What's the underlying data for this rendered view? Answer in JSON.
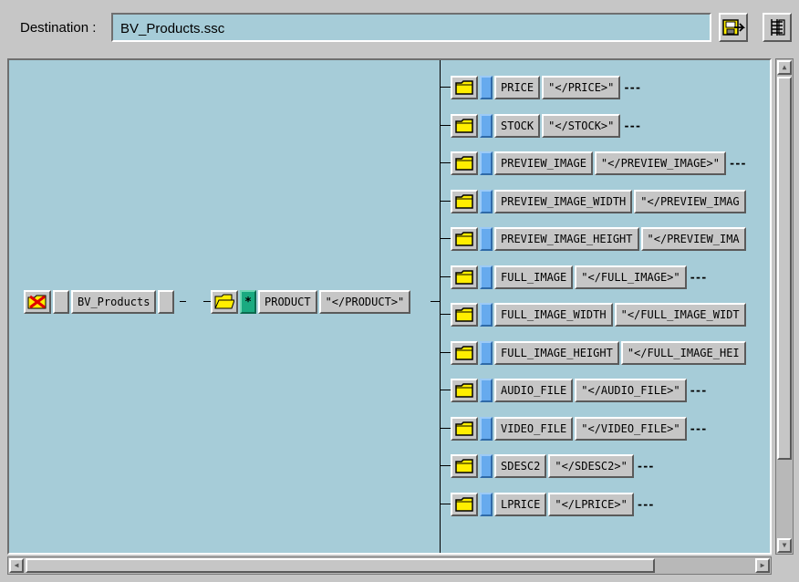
{
  "destination": {
    "label": "Destination :",
    "value": "BV_Products.ssc"
  },
  "toolbar": {
    "icons": [
      "save-icon",
      "tree-layout-icon"
    ]
  },
  "tree": {
    "root": {
      "name": "BV_Products"
    },
    "product": {
      "name": "PRODUCT",
      "close_tag": "\"</PRODUCT>\"",
      "marker": "*"
    },
    "children": [
      {
        "name": "PRICE",
        "close_tag": "\"</PRICE>\"",
        "suffix": "---"
      },
      {
        "name": "STOCK",
        "close_tag": "\"</STOCK>\"",
        "suffix": "---"
      },
      {
        "name": "PREVIEW_IMAGE",
        "close_tag": "\"</PREVIEW_IMAGE>\"",
        "suffix": "---"
      },
      {
        "name": "PREVIEW_IMAGE_WIDTH",
        "close_tag": "\"</PREVIEW_IMAG",
        "suffix": ""
      },
      {
        "name": "PREVIEW_IMAGE_HEIGHT",
        "close_tag": "\"</PREVIEW_IMA",
        "suffix": ""
      },
      {
        "name": "FULL_IMAGE",
        "close_tag": "\"</FULL_IMAGE>\"",
        "suffix": "---"
      },
      {
        "name": "FULL_IMAGE_WIDTH",
        "close_tag": "\"</FULL_IMAGE_WIDT",
        "suffix": ""
      },
      {
        "name": "FULL_IMAGE_HEIGHT",
        "close_tag": "\"</FULL_IMAGE_HEI",
        "suffix": ""
      },
      {
        "name": "AUDIO_FILE",
        "close_tag": "\"</AUDIO_FILE>\"",
        "suffix": "---"
      },
      {
        "name": "VIDEO_FILE",
        "close_tag": "\"</VIDEO_FILE>\"",
        "suffix": "---"
      },
      {
        "name": "SDESC2",
        "close_tag": "\"</SDESC2>\"",
        "suffix": "---"
      },
      {
        "name": "LPRICE",
        "close_tag": "\"</LPRICE>\"",
        "suffix": "---"
      }
    ]
  },
  "colors": {
    "canvas_bg": "#a6ccd8",
    "folder": "#ffee00",
    "element_marker": "#66aaee",
    "product_marker": "#1aaa80"
  }
}
